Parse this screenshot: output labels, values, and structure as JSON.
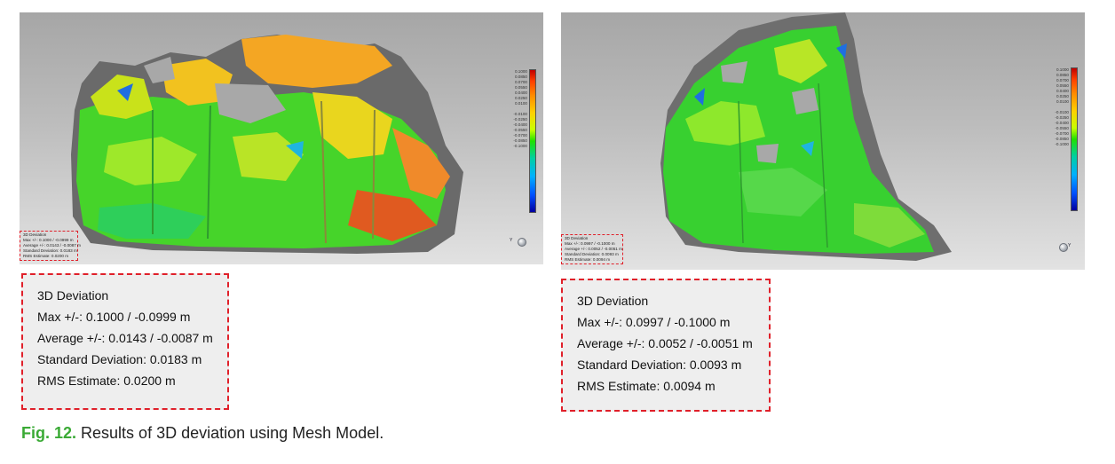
{
  "figure": {
    "label": "Fig. 12.",
    "caption": "Results of 3D deviation using Mesh Model.",
    "accent_color": "#3aaa35",
    "highlight_color": "#e0202a"
  },
  "colormap": [
    "#0000a0",
    "#0050ff",
    "#00b0ff",
    "#00d0a0",
    "#20e000",
    "#c8ff00",
    "#ffd000",
    "#ff8c00",
    "#ff4000",
    "#c00000"
  ],
  "left": {
    "scale_ticks": [
      "0.1000",
      "0.0850",
      "0.0700",
      "0.0550",
      "0.0400",
      "0.0250",
      "0.0100",
      "",
      "-0.0100",
      "-0.0250",
      "-0.0400",
      "-0.0550",
      "-0.0700",
      "-0.0850",
      "-0.1000"
    ],
    "axis_label": "Y",
    "mini_summary": {
      "title": "3D Deviation",
      "max": "Max +/-: 0.1000 / -0.0999 m",
      "average": "Average +/-: 0.0143 / -0.0087 m",
      "std": "Standard Deviation: 0.0183 m",
      "rms": "RMS Estimate: 0.0200 m"
    },
    "deviation": {
      "title": "3D Deviation",
      "max": "Max +/-: 0.1000 / -0.0999 m",
      "average": "Average +/-: 0.0143 / -0.0087 m",
      "std": "Standard Deviation: 0.0183 m",
      "rms": "RMS Estimate: 0.0200 m"
    }
  },
  "right": {
    "scale_ticks": [
      "0.1000",
      "0.0850",
      "0.0700",
      "0.0550",
      "0.0400",
      "0.0250",
      "0.0100",
      "",
      "-0.0100",
      "-0.0250",
      "-0.0400",
      "-0.0550",
      "-0.0700",
      "-0.0850",
      "-0.1000"
    ],
    "axis_label": "Y",
    "mini_summary": {
      "title": "3D Deviation",
      "max": "Max +/-: 0.0997 / -0.1000 m",
      "average": "Average +/-: 0.0052 / -0.0051 m",
      "std": "Standard Deviation: 0.0093 m",
      "rms": "RMS Estimate: 0.0094 m"
    },
    "deviation": {
      "title": "3D Deviation",
      "max": "Max +/-: 0.0997 / -0.1000 m",
      "average": "Average +/-: 0.0052 / -0.0051 m",
      "std": "Standard Deviation: 0.0093 m",
      "rms": "RMS Estimate: 0.0094 m"
    }
  }
}
